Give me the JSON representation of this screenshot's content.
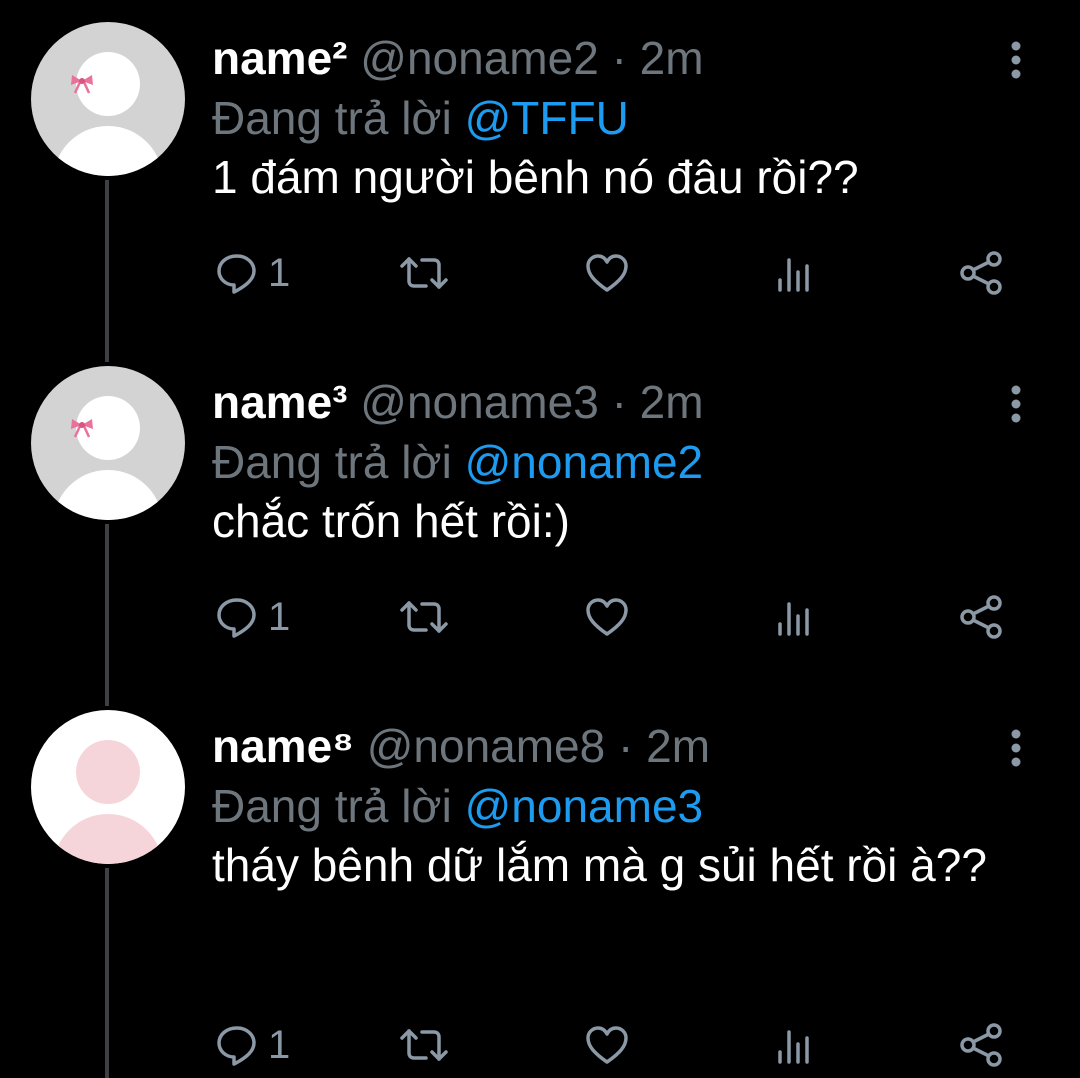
{
  "tweets": [
    {
      "display_name": "name²",
      "handle": "@noname2",
      "time": "2m",
      "replying_prefix": "Đang trả lời ",
      "replying_to": "@TFFU",
      "text": "1 đám người bênh nó đâu rồi??",
      "reply_count": "1",
      "avatar_style": "grey-with-bow"
    },
    {
      "display_name": "name³",
      "handle": "@noname3",
      "time": "2m",
      "replying_prefix": "Đang trả lời ",
      "replying_to": "@noname2",
      "text": "chắc trốn hết rồi:)",
      "reply_count": "1",
      "avatar_style": "grey-with-bow"
    },
    {
      "display_name": "name⁸",
      "handle": "@noname8",
      "time": "2m",
      "replying_prefix": "Đang trả lời ",
      "replying_to": "@noname3",
      "text": "tháy bênh dữ lắm mà g sủi hết rồi à??",
      "reply_count": "1",
      "avatar_style": "white-pink"
    }
  ],
  "separator": "·",
  "colors": {
    "background": "#000000",
    "muted": "#6e767d",
    "mention": "#1d9bf0",
    "icon": "#8b98a5"
  },
  "icons": [
    "reply-icon",
    "retweet-icon",
    "like-icon",
    "views-icon",
    "share-icon",
    "more-icon"
  ]
}
